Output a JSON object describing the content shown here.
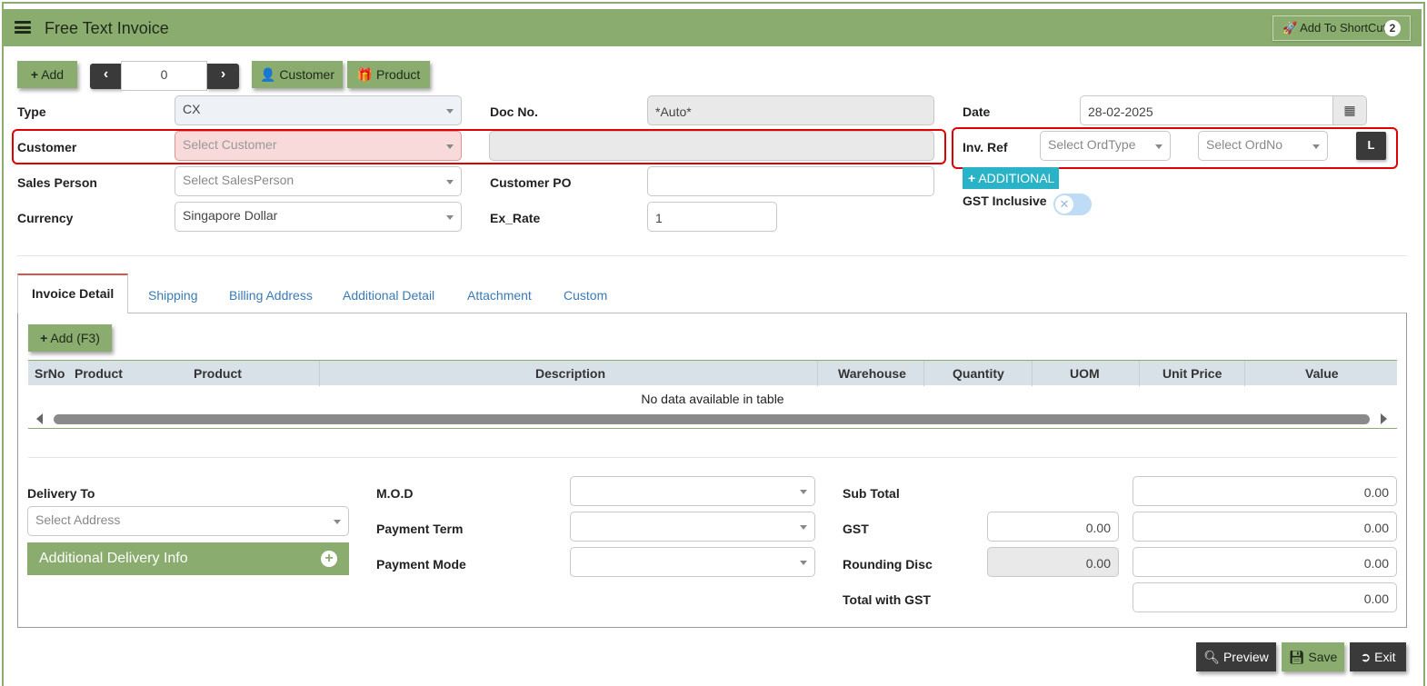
{
  "header": {
    "title": "Free Text Invoice",
    "shortcut_label": "Add To ShortCut",
    "shortcut_badge": "2"
  },
  "toolbar": {
    "add_label": "Add",
    "nav_value": "0",
    "customer_label": "Customer",
    "product_label": "Product"
  },
  "form": {
    "type_label": "Type",
    "type_value": "CX",
    "docno_label": "Doc No.",
    "docno_value": "*Auto*",
    "date_label": "Date",
    "date_value": "28-02-2025",
    "customer_label": "Customer",
    "customer_placeholder": "Select Customer",
    "invref_label": "Inv. Ref",
    "ordtype_placeholder": "Select OrdType",
    "ordno_placeholder": "Select OrdNo",
    "l_button": "L",
    "additional_label": "ADDITIONAL",
    "salesperson_label": "Sales Person",
    "salesperson_placeholder": "Select SalesPerson",
    "customerpo_label": "Customer PO",
    "gst_inclusive_label": "GST Inclusive",
    "currency_label": "Currency",
    "currency_value": "Singapore Dollar",
    "exrate_label": "Ex_Rate",
    "exrate_value": "1"
  },
  "tabs": [
    "Invoice Detail",
    "Shipping",
    "Billing Address",
    "Additional Detail",
    "Attachment",
    "Custom"
  ],
  "detail": {
    "add_label": "Add (F3)",
    "columns": [
      "SrNo",
      "Product",
      "Product",
      "Description",
      "Warehouse",
      "Quantity",
      "UOM",
      "Unit Price",
      "Value"
    ],
    "empty_text": "No data available in table"
  },
  "footer": {
    "delivery_label": "Delivery To",
    "address_placeholder": "Select Address",
    "additional_delivery_label": "Additional Delivery Info",
    "mod_label": "M.O.D",
    "payment_term_label": "Payment Term",
    "payment_mode_label": "Payment Mode",
    "subtotal_label": "Sub Total",
    "subtotal_value": "0.00",
    "gst_label": "GST",
    "gst_rate_value": "0.00",
    "gst_value": "0.00",
    "rounding_label": "Rounding Disc",
    "rounding_rate_value": "0.00",
    "rounding_value": "0.00",
    "total_label": "Total with GST",
    "total_value": "0.00"
  },
  "actions": {
    "preview_label": "Preview",
    "save_label": "Save",
    "exit_label": "Exit"
  },
  "colors": {
    "accent": "#8aac6e",
    "dark": "#3a3a3a",
    "danger": "#e00000",
    "info": "#2ab3c6"
  }
}
